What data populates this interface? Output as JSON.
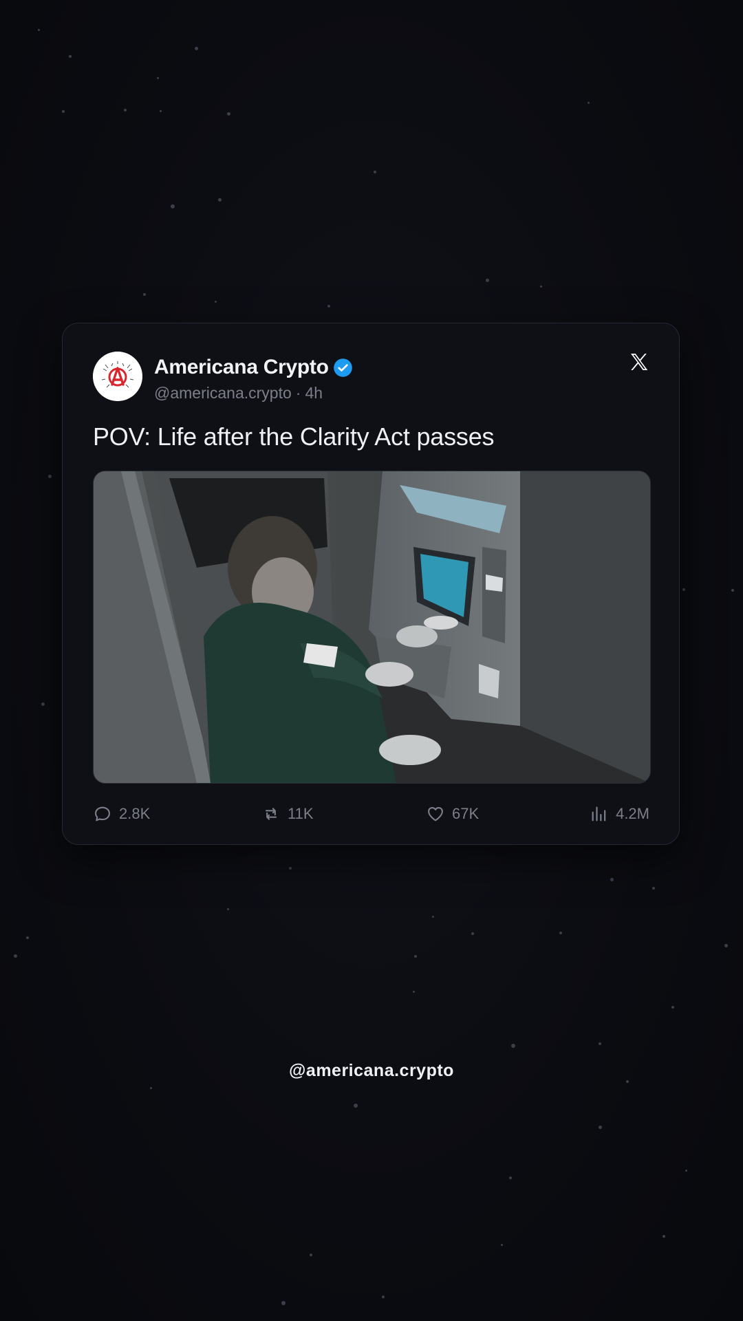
{
  "post": {
    "author_name": "Americana Crypto",
    "author_handle": "@americana.crypto",
    "separator": "·",
    "time_ago": "4h",
    "text": "POV: Life after the Clarity Act passes",
    "verified": true,
    "platform_icon": "x-logo-icon",
    "avatar_icon": "anarchy-a-logo-icon",
    "media_description_icon": "video-thumbnail"
  },
  "stats": {
    "replies": "2.8K",
    "reposts": "11K",
    "likes": "67K",
    "views": "4.2M"
  },
  "footer": {
    "handle": "@americana.crypto"
  },
  "colors": {
    "background": "#0b0c11",
    "card": "#0f1016",
    "verified_blue": "#1d9bf0",
    "avatar_red": "#d9262c"
  }
}
